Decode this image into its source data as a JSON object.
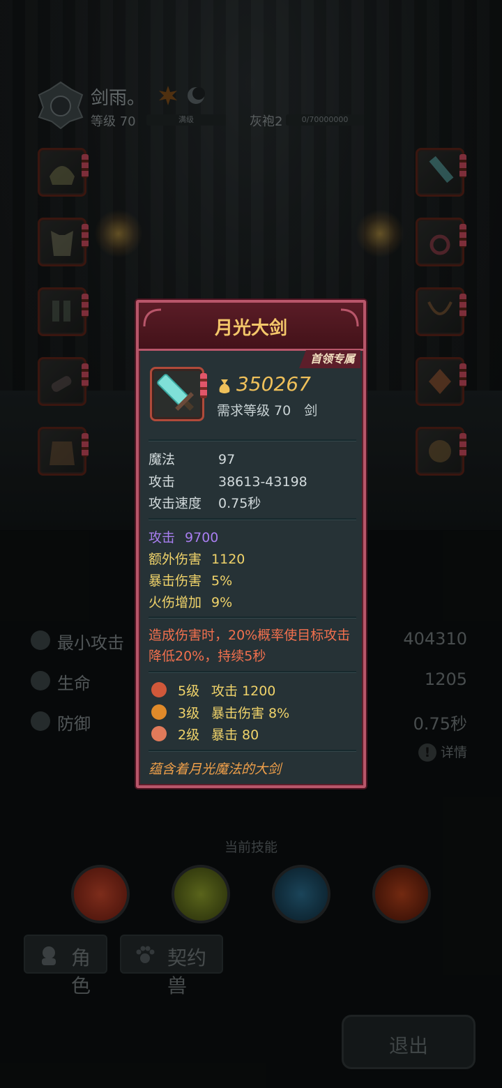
{
  "player": {
    "name": "剑雨。",
    "level_label": "等级 70",
    "level_bar_text": "满级",
    "rank_label": "灰袍2",
    "rank_bar_text": "0/70000000"
  },
  "stats": [
    {
      "icon": "sword-icon",
      "label": "最小攻击",
      "value": "404310"
    },
    {
      "icon": "heart-icon",
      "label": "生命",
      "value": "1205"
    },
    {
      "icon": "shield-icon",
      "label": "防御",
      "value": "0.75秒"
    }
  ],
  "detail_label": "详情",
  "skills_title": "当前技能",
  "skills": [
    {
      "icon": "crossed-axes-icon",
      "color": "#b3321f"
    },
    {
      "icon": "bubbles-icon",
      "color": "#6a7a22"
    },
    {
      "icon": "water-drop-shield-icon",
      "color": "#1f4f6a"
    },
    {
      "icon": "fire-crest-icon",
      "color": "#8a2a1a"
    }
  ],
  "tabs": {
    "character": "角色",
    "pet": "契约兽"
  },
  "exit_label": "退出",
  "popup": {
    "title": "月光大剑",
    "tag": "首领专属",
    "gold_value": "350267",
    "requirement": "需求等级 70　剑",
    "base_stats": [
      {
        "label": "魔法",
        "value": "97"
      },
      {
        "label": "攻击",
        "value": "38613-43198"
      },
      {
        "label": "攻击速度",
        "value": "0.75秒"
      }
    ],
    "bonus_stats": [
      {
        "label": "攻击",
        "value": "9700"
      },
      {
        "label": "额外伤害",
        "value": "1120"
      },
      {
        "label": "暴击伤害",
        "value": "5%"
      },
      {
        "label": "火伤增加",
        "value": "9%"
      }
    ],
    "effect": "造成伤害时，20%概率使目标攻击降低20%，持续5秒",
    "gems": [
      {
        "level": "5级",
        "stat": "攻击 1200",
        "color": "#d0583a"
      },
      {
        "level": "3级",
        "stat": "暴击伤害 8%",
        "color": "#e08a2a"
      },
      {
        "level": "2级",
        "stat": "暴击 80",
        "color": "#e07a5a"
      }
    ],
    "flavor": "蕴含着月光魔法的大剑"
  },
  "colors": {
    "frame": "#b8566a",
    "title": "#f4c76a",
    "gold": "#efc05a",
    "bonus": "#f0d36a",
    "bonus_purple": "#a87ef0",
    "effect": "#f2704e",
    "flavor": "#f0a04a"
  }
}
